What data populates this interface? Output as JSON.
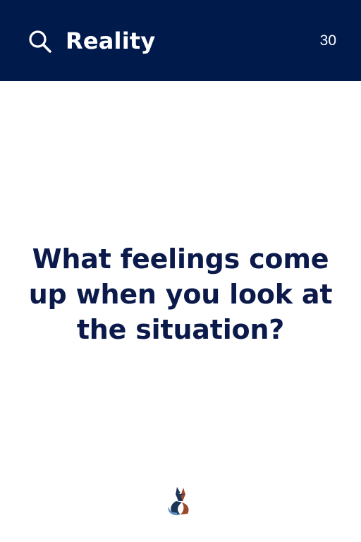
{
  "header": {
    "title": "Reality",
    "count": "30",
    "search_icon": "search-icon"
  },
  "card": {
    "question": "What feelings come up when you look at the situation?"
  },
  "footer": {
    "logo_icon": "fox-logo-icon"
  },
  "colors": {
    "header_bg": "#011a4c",
    "header_text": "#ffffff",
    "question_text": "#0b1a4a",
    "background": "#ffffff",
    "logo_navy": "#1c3556",
    "logo_rust": "#9a4a2c",
    "logo_sky": "#5f8fc0"
  }
}
